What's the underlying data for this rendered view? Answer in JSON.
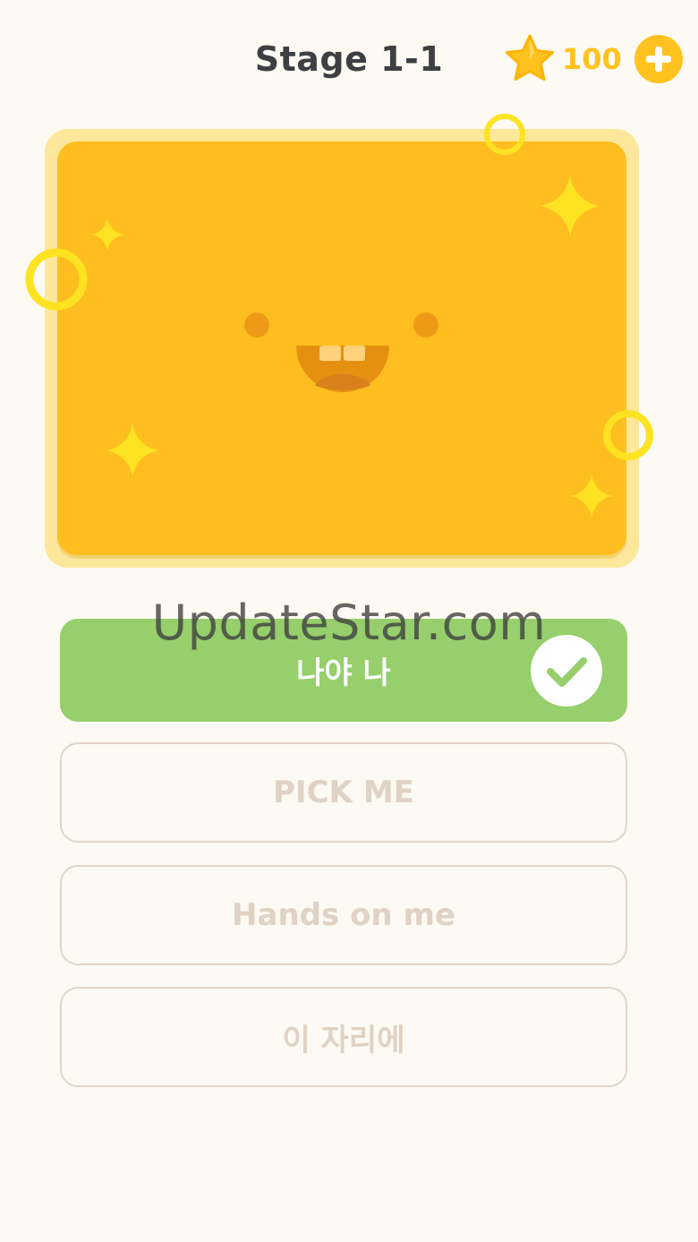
{
  "header": {
    "stage_title": "Stage 1-1",
    "coins": "100",
    "star_icon": "star-icon",
    "add_icon": "plus-icon"
  },
  "card": {
    "color": "#ffbe1f",
    "glow_color": "#fde79a",
    "character": "smiling-face"
  },
  "watermark": "UpdateStar.com",
  "options": [
    {
      "label": "나야 나",
      "state": "correct",
      "icon": "checkmark-icon"
    },
    {
      "label": "PICK ME",
      "state": "default"
    },
    {
      "label": "Hands on me",
      "state": "default"
    },
    {
      "label": "이 자리에",
      "state": "default"
    }
  ],
  "colors": {
    "background": "#fcfaf2",
    "accent_gold": "#ffc21e",
    "correct_green": "#96cf6c",
    "title_text": "#3d3f42",
    "option_border": "#e2d5c8",
    "option_text": "#e0d2c4"
  }
}
